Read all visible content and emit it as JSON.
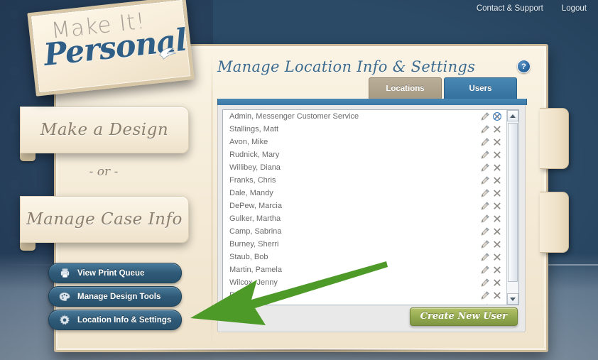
{
  "topbar": {
    "links": [
      {
        "label": "Contact & Support"
      },
      {
        "label": "Logout"
      }
    ]
  },
  "logo": {
    "line1": "Make It!",
    "line2": "Personal",
    "bird_icon": "bird-icon"
  },
  "sidebar": {
    "ribbons": [
      {
        "label": "Make a Design"
      },
      {
        "label": "Manage Case Info"
      }
    ],
    "or_label": "- or -",
    "pills": [
      {
        "label": "View Print Queue",
        "icon": "printer-icon"
      },
      {
        "label": "Manage Design Tools",
        "icon": "palette-icon"
      },
      {
        "label": "Location Info & Settings",
        "icon": "gear-icon"
      }
    ]
  },
  "content": {
    "title": "Manage Location Info & Settings",
    "help_label": "?",
    "tabs": [
      {
        "label": "Locations",
        "active": false
      },
      {
        "label": "Users",
        "active": true
      }
    ],
    "users": [
      {
        "name": "Admin, Messenger Customer Service",
        "delete_disabled": true
      },
      {
        "name": "Stallings, Matt",
        "delete_disabled": false
      },
      {
        "name": "Avon, Mike",
        "delete_disabled": false
      },
      {
        "name": "Rudnick, Mary",
        "delete_disabled": false
      },
      {
        "name": "Willibey, Diana",
        "delete_disabled": false
      },
      {
        "name": "Franks, Chris",
        "delete_disabled": false
      },
      {
        "name": "Dale, Mandy",
        "delete_disabled": false
      },
      {
        "name": "DePew, Marcia",
        "delete_disabled": false
      },
      {
        "name": "Gulker, Martha",
        "delete_disabled": false
      },
      {
        "name": "Camp, Sabrina",
        "delete_disabled": false
      },
      {
        "name": "Burney, Sherri",
        "delete_disabled": false
      },
      {
        "name": "Staub, Bob",
        "delete_disabled": false
      },
      {
        "name": "Martin, Pamela",
        "delete_disabled": false
      },
      {
        "name": "Wilcox, Jenny",
        "delete_disabled": false
      },
      {
        "name": "Frank",
        "delete_disabled": false
      },
      {
        "name": "",
        "delete_disabled": false
      }
    ],
    "create_button": "Create New User"
  },
  "annotation": {
    "arrow_color": "#4e9a28",
    "points_to": "Location Info & Settings"
  },
  "colors": {
    "accent_blue": "#35719e",
    "tab_inactive": "#a79a82",
    "green_button": "#93a94f",
    "panel_cream": "#f4ead6",
    "background_navy": "#27405c"
  }
}
